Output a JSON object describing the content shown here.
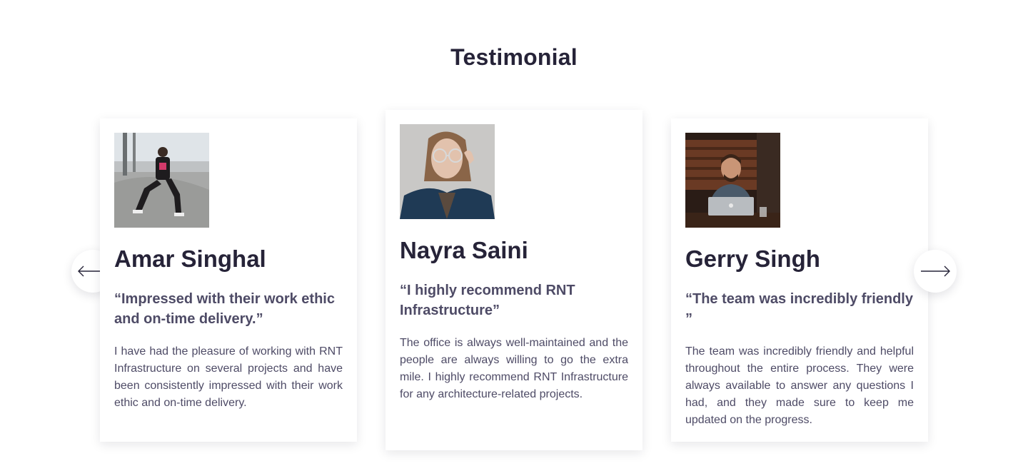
{
  "section": {
    "title": "Testimonial"
  },
  "colors": {
    "heading": "#262338",
    "text": "#4e4b66",
    "card_bg": "#ffffff"
  },
  "navigation": {
    "prev_icon": "arrow-left-icon",
    "next_icon": "arrow-right-icon"
  },
  "testimonials": [
    {
      "name": "Amar Singhal",
      "quote": "“Impressed with their work ethic and on-time delivery.”",
      "body": "I have had the pleasure of working with RNT Infrastructure on several projects and have been consistently impressed with their work ethic and on-time delivery.",
      "photo": "skateboarder-photo"
    },
    {
      "name": "Nayra Saini",
      "quote": "“I highly recommend RNT Infrastructure”",
      "body": "The office is always well-maintained and the people are always willing to go the extra mile. I highly recommend RNT Infrastructure for any architecture-related projects.",
      "photo": "woman-glasses-photo"
    },
    {
      "name": "Gerry Singh",
      "quote": "“The team was incredibly friendly ”",
      "body": "The team was incredibly friendly and helpful throughout the entire process. They were always available to answer any questions I had, and they made sure to keep me updated on the progress.",
      "photo": "man-laptop-photo"
    }
  ]
}
